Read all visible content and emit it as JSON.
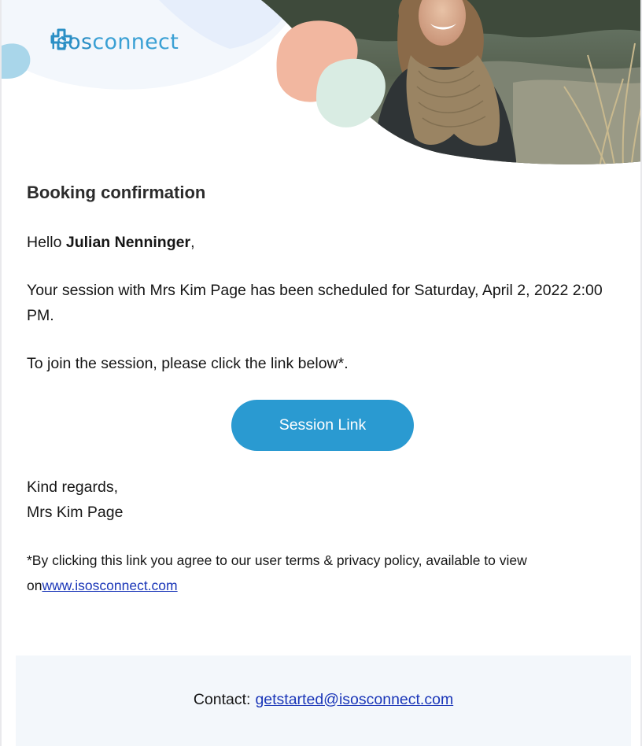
{
  "brand": {
    "logo_text_prefix": "isos",
    "logo_text_suffix": "connect",
    "logo_icon": "plus-leaf-logo-icon",
    "primary_color": "#2a9ad1"
  },
  "hero": {
    "image": "photo of smiling woman wearing knit scarf outdoors",
    "blob_colors": [
      "#f2b7a0",
      "#d9ece3",
      "#e7eefa",
      "#a9d6ea"
    ]
  },
  "email": {
    "heading": "Booking confirmation",
    "greeting_prefix": "Hello ",
    "recipient_name": "Julian Nenninger",
    "greeting_suffix": ",",
    "session_text": "Your session with Mrs Kim Page has been scheduled for Saturday, April 2, 2022 2:00 PM.",
    "join_text": "To join the session, please click the link below*.",
    "session_button_label": "Session Link",
    "closing": "Kind regards,",
    "signature": "Mrs Kim Page",
    "terms_text": "*By clicking this link you agree to our user terms & privacy policy, available to view on",
    "terms_link_text": "www.isosconnect.com"
  },
  "footer": {
    "contact_label": "Contact:",
    "contact_email": "getstarted@isosconnect.com"
  }
}
